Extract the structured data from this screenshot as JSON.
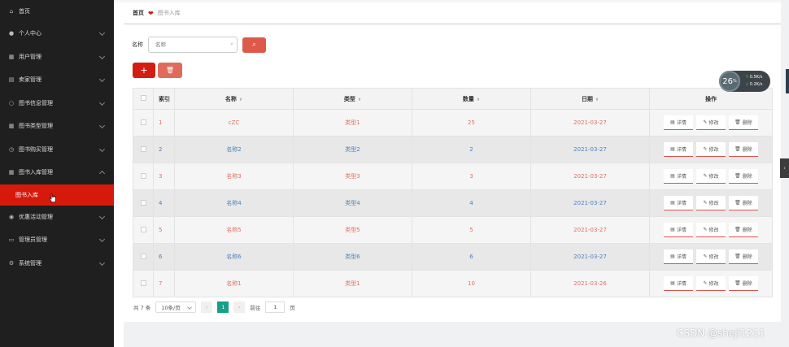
{
  "sidebar": {
    "items": [
      {
        "label": "首页",
        "icon": "home-icon",
        "chevron": false
      },
      {
        "label": "个人中心",
        "icon": "user-icon",
        "chevron": true
      },
      {
        "label": "用户管理",
        "icon": "grid-icon",
        "chevron": true
      },
      {
        "label": "卖家管理",
        "icon": "shop-icon",
        "chevron": true
      },
      {
        "label": "图书信息管理",
        "icon": "info-icon",
        "chevron": true
      },
      {
        "label": "图书类型管理",
        "icon": "grid-icon",
        "chevron": true
      },
      {
        "label": "图书购买管理",
        "icon": "clock-icon",
        "chevron": true
      },
      {
        "label": "图书入库管理",
        "icon": "grid-icon",
        "chevron": true,
        "expanded": true
      }
    ],
    "submenu": {
      "label": "图书入库"
    },
    "items_after": [
      {
        "label": "优惠活动管理",
        "icon": "mic-icon",
        "chevron": true
      },
      {
        "label": "管理员管理",
        "icon": "chat-icon",
        "chevron": true
      },
      {
        "label": "系统管理",
        "icon": "gear-icon",
        "chevron": true
      }
    ]
  },
  "breadcrumb": {
    "home": "首页",
    "current": "图书入库"
  },
  "search": {
    "label": "名称",
    "placeholder": "名称"
  },
  "table": {
    "headers": {
      "index": "索引",
      "name": "名称",
      "type": "类型",
      "quantity": "数量",
      "date": "日期",
      "ops": "操作"
    },
    "rows": [
      {
        "index": "1",
        "name": "cZC",
        "type": "类型1",
        "quantity": "25",
        "date": "2021-03-27"
      },
      {
        "index": "2",
        "name": "名称2",
        "type": "类型2",
        "quantity": "2",
        "date": "2021-03-27"
      },
      {
        "index": "3",
        "name": "名称3",
        "type": "类型3",
        "quantity": "3",
        "date": "2021-03-27"
      },
      {
        "index": "4",
        "name": "名称4",
        "type": "类型4",
        "quantity": "4",
        "date": "2021-03-27"
      },
      {
        "index": "5",
        "name": "名称5",
        "type": "类型5",
        "quantity": "5",
        "date": "2021-03-27"
      },
      {
        "index": "6",
        "name": "名称6",
        "type": "类型6",
        "quantity": "6",
        "date": "2021-03-27"
      },
      {
        "index": "7",
        "name": "名称1",
        "type": "类型1",
        "quantity": "10",
        "date": "2021-03-26"
      }
    ],
    "ops": {
      "detail": "详情",
      "edit": "修改",
      "delete": "删除"
    }
  },
  "pager": {
    "total": "共 7 条",
    "page_size": "10条/页",
    "prev": "‹",
    "current": "1",
    "next": "›",
    "goto_label": "前往",
    "goto_value": "1",
    "page_unit": "页"
  },
  "widget": {
    "percent": "26",
    "percent_unit": "%",
    "up": "0.5",
    "down": "0.2",
    "up_unit": "K/s",
    "down_unit": "K/s"
  },
  "watermark": "CSDN @sheji1211",
  "colors": {
    "accent_red": "#d41d12",
    "sidebar_bg": "#1f1f1f",
    "pager_active": "#16a085"
  }
}
